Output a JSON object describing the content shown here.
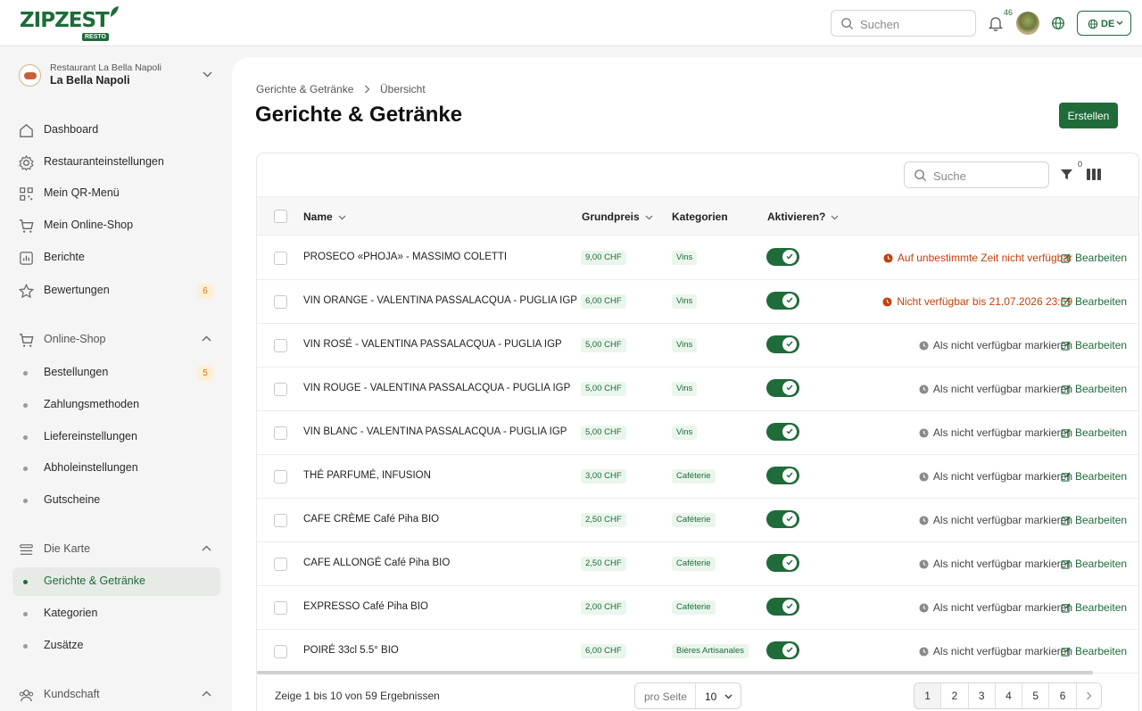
{
  "brand": {
    "name": "ZIPZEST",
    "badge": "RESTO"
  },
  "topbar": {
    "search_placeholder": "Suchen",
    "notification_count": "46",
    "language": "DE"
  },
  "restaurant": {
    "label": "Restaurant La Bella Napoli",
    "name": "La Bella Napoli"
  },
  "sidebar": {
    "main_items": [
      {
        "label": "Dashboard"
      },
      {
        "label": "Restauranteinstellungen"
      },
      {
        "label": "Mein QR-Menü"
      },
      {
        "label": "Mein Online-Shop"
      },
      {
        "label": "Berichte"
      },
      {
        "label": "Bewertungen",
        "badge": "6"
      }
    ],
    "shop_section": {
      "label": "Online-Shop"
    },
    "shop_items": [
      {
        "label": "Bestellungen",
        "badge": "5"
      },
      {
        "label": "Zahlungsmethoden"
      },
      {
        "label": "Liefereinstellungen"
      },
      {
        "label": "Abholeinstellungen"
      },
      {
        "label": "Gutscheine"
      }
    ],
    "menu_section": {
      "label": "Die Karte"
    },
    "menu_items": [
      {
        "label": "Gerichte & Getränke"
      },
      {
        "label": "Kategorien"
      },
      {
        "label": "Zusätze"
      }
    ],
    "customers_section": {
      "label": "Kundschaft"
    }
  },
  "page": {
    "breadcrumb": [
      "Gerichte & Getränke",
      "Übersicht"
    ],
    "title": "Gerichte & Getränke",
    "create_label": "Erstellen"
  },
  "table": {
    "search_placeholder": "Suche",
    "filter_count": "0",
    "headers": {
      "name": "Name",
      "price": "Grundpreis",
      "categories": "Kategorien",
      "active": "Aktivieren?"
    },
    "edit_label": "Bearbeiten",
    "rows": [
      {
        "name": "PROSECO «PHOJA» - MASSIMO COLETTI",
        "price": "9,00 CHF",
        "category": "Vins",
        "active": true,
        "status": "Auf unbestimmte Zeit nicht verfügbar",
        "status_type": "warn"
      },
      {
        "name": "VIN ORANGE - VALENTINA PASSALACQUA - PUGLIA IGP",
        "price": "6,00 CHF",
        "category": "Vins",
        "active": true,
        "status": "Nicht verfügbar bis 21.07.2026 23:59",
        "status_type": "warn"
      },
      {
        "name": "VIN ROSÉ - VALENTINA PASSALACQUA - PUGLIA IGP",
        "price": "5,00 CHF",
        "category": "Vins",
        "active": true,
        "status": "Als nicht verfügbar markieren",
        "status_type": "norm"
      },
      {
        "name": "VIN ROUGE - VALENTINA PASSALACQUA - PUGLIA IGP",
        "price": "5,00 CHF",
        "category": "Vins",
        "active": true,
        "status": "Als nicht verfügbar markieren",
        "status_type": "norm"
      },
      {
        "name": "VIN BLANC - VALENTINA PASSALACQUA - PUGLIA IGP",
        "price": "5,00 CHF",
        "category": "Vins",
        "active": true,
        "status": "Als nicht verfügbar markieren",
        "status_type": "norm"
      },
      {
        "name": "THÉ PARFUMÉ, INFUSION",
        "price": "3,00 CHF",
        "category": "Caféterie",
        "active": true,
        "status": "Als nicht verfügbar markieren",
        "status_type": "norm"
      },
      {
        "name": "CAFE CRÈME Café Piha BIO",
        "price": "2,50 CHF",
        "category": "Caféterie",
        "active": true,
        "status": "Als nicht verfügbar markieren",
        "status_type": "norm"
      },
      {
        "name": "CAFE ALLONGÉ Café Piha BIO",
        "price": "2,50 CHF",
        "category": "Caféterie",
        "active": true,
        "status": "Als nicht verfügbar markieren",
        "status_type": "norm"
      },
      {
        "name": "EXPRESSO Café Piha BIO",
        "price": "2,00 CHF",
        "category": "Caféterie",
        "active": true,
        "status": "Als nicht verfügbar markieren",
        "status_type": "norm"
      },
      {
        "name": "POIRÉ 33cl 5.5° BIO",
        "price": "6,00 CHF",
        "category": "Bières Artisanales",
        "active": true,
        "status": "Als nicht verfügbar markieren",
        "status_type": "norm"
      }
    ]
  },
  "footer": {
    "result_text": "Zeige 1 bis 10 von 59 Ergebnissen",
    "per_page_label": "pro Seite",
    "per_page_value": "10",
    "pages": [
      "1",
      "2",
      "3",
      "4",
      "5",
      "6"
    ],
    "current_page": "1"
  },
  "colors": {
    "brand": "#1f6b3a",
    "warning": "#c2410c",
    "badge": "#d97706"
  }
}
